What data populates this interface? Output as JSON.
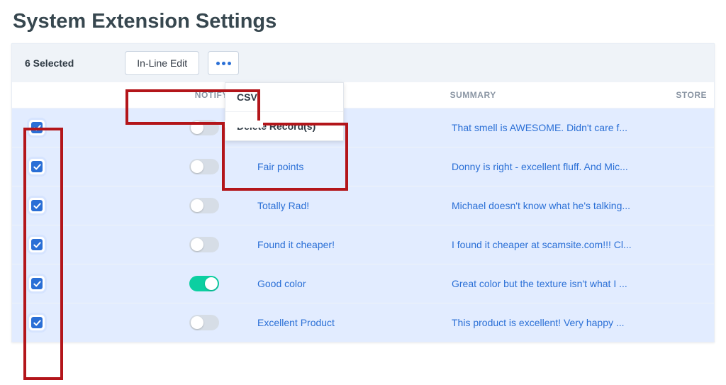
{
  "header": {
    "title": "System Extension Settings"
  },
  "toolbar": {
    "selected_text": "6 Selected",
    "inline_edit_label": "In-Line Edit",
    "dropdown": {
      "csv_label": "CSV",
      "delete_label": "Delete Record(s)"
    }
  },
  "columns": {
    "notify": "NOTIFY",
    "summary": "SUMMARY",
    "store": "STORE"
  },
  "rows": [
    {
      "checked": true,
      "notify": false,
      "title": "",
      "summary": "That smell is AWESOME. Didn't care f..."
    },
    {
      "checked": true,
      "notify": false,
      "title": "Fair points",
      "summary": "Donny is right - excellent fluff. And Mic..."
    },
    {
      "checked": true,
      "notify": false,
      "title": "Totally Rad!",
      "summary": "Michael doesn't know what he's talking..."
    },
    {
      "checked": true,
      "notify": false,
      "title": "Found it cheaper!",
      "summary": "I found it cheaper at scamsite.com!!! Cl..."
    },
    {
      "checked": true,
      "notify": true,
      "title": "Good color",
      "summary": "Great color but the texture isn't what I ..."
    },
    {
      "checked": true,
      "notify": false,
      "title": "Excellent Product",
      "summary": "This product is excellent! Very happy ..."
    }
  ]
}
